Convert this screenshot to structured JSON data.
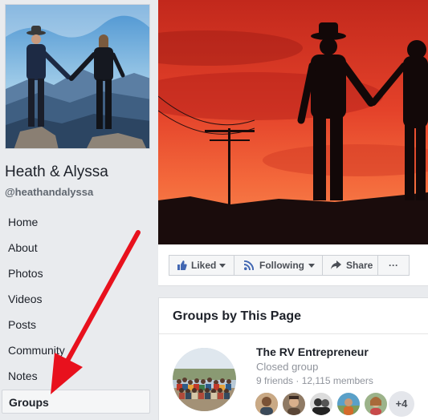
{
  "page": {
    "name": "Heath & Alyssa",
    "handle": "@heathandalyssa"
  },
  "sidebar": {
    "items": [
      {
        "label": "Home"
      },
      {
        "label": "About"
      },
      {
        "label": "Photos"
      },
      {
        "label": "Videos"
      },
      {
        "label": "Posts"
      },
      {
        "label": "Community"
      },
      {
        "label": "Notes"
      },
      {
        "label": "Groups",
        "active": true
      }
    ]
  },
  "actions": {
    "liked": "Liked",
    "following": "Following",
    "share": "Share",
    "more": "···"
  },
  "groups": {
    "title": "Groups by This Page",
    "group": {
      "name": "The RV Entrepreneur",
      "privacy": "Closed group",
      "stats": "9 friends · 12,115 members",
      "extra_members": "+4"
    }
  },
  "colors": {
    "accent_blue": "#4267b2",
    "annotation_arrow": "#e8111d"
  },
  "icons": {
    "liked": "thumbs-up-icon",
    "following": "rss-icon",
    "share": "share-arrow-icon",
    "more": "ellipsis-icon"
  }
}
